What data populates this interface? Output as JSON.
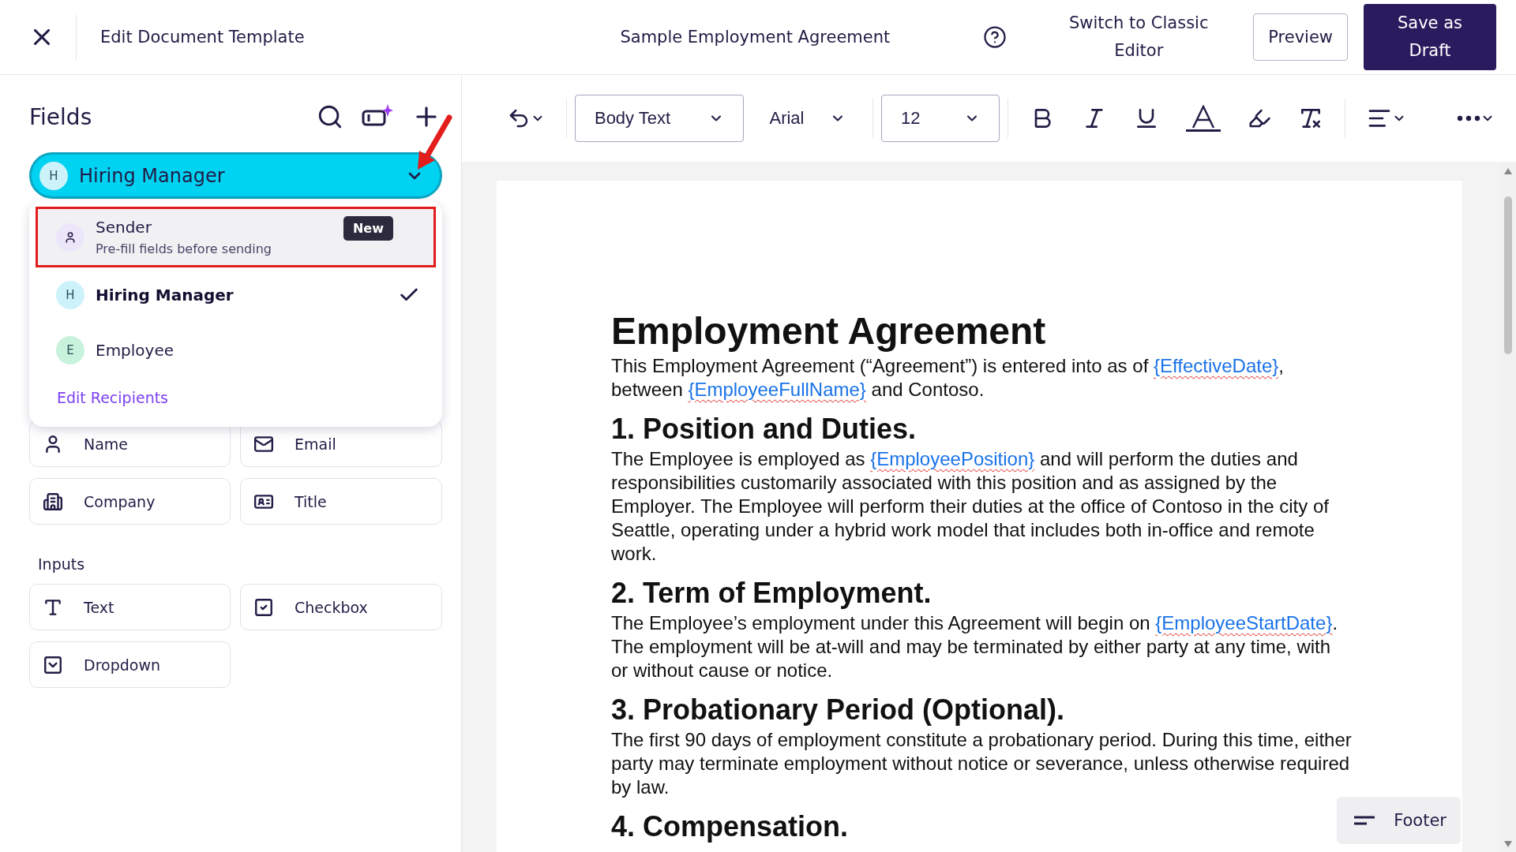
{
  "header": {
    "title": "Edit Document Template",
    "document_name": "Sample Employment Agreement",
    "switch_link": "Switch to Classic Editor",
    "buttons": [
      {
        "label": "Preview",
        "kind": "secondary"
      },
      {
        "label": "Save as Draft",
        "kind": "primary"
      }
    ]
  },
  "sidebar": {
    "title": "Fields",
    "recipient_selector": {
      "initial": "H",
      "label": "Hiring Manager",
      "color": "#cdf3fa",
      "expanded": true,
      "annotated": true
    },
    "recipient_menu": {
      "items": [
        {
          "kind": "person",
          "name": "Sender",
          "description": "Pre-fill fields before sending",
          "badge": "New",
          "selected": false,
          "annotated": true,
          "color": "#ece6fb"
        },
        {
          "kind": "initial",
          "initial": "H",
          "name": "Hiring Manager",
          "selected": true,
          "annotated": false,
          "color": "#cdf3fa"
        },
        {
          "kind": "initial",
          "initial": "E",
          "name": "Employee",
          "selected": false,
          "annotated": false,
          "color": "#c9f2dc"
        }
      ],
      "footer_link": "Edit Recipients"
    },
    "field_groups": [
      {
        "fields": [
          {
            "label": "Name",
            "kind": "person"
          },
          {
            "label": "Email",
            "kind": "email"
          },
          {
            "label": "Company",
            "kind": "company"
          },
          {
            "label": "Title",
            "kind": "title"
          }
        ]
      },
      {
        "title": "Inputs",
        "fields": [
          {
            "label": "Text",
            "kind": "text"
          },
          {
            "label": "Checkbox",
            "kind": "checkbox"
          },
          {
            "label": "Dropdown",
            "kind": "dropdown"
          }
        ]
      }
    ]
  },
  "toolbar": {
    "style_select": "Body Text",
    "font_select": "Arial",
    "size_select": "12"
  },
  "document": {
    "blocks": [
      {
        "kind": "title",
        "parts": [
          {
            "kind": "text",
            "text": "Employment Agreement"
          }
        ]
      },
      {
        "kind": "paragraph",
        "parts": [
          {
            "kind": "text",
            "text": "This Employment Agreement (“Agreement”) is entered into as of "
          },
          {
            "kind": "field",
            "text": "{EffectiveDate}"
          },
          {
            "kind": "text",
            "text": ", between "
          },
          {
            "kind": "field",
            "text": "{EmployeeFullName}"
          },
          {
            "kind": "text",
            "text": " and Contoso."
          }
        ]
      },
      {
        "kind": "heading",
        "parts": [
          {
            "kind": "text",
            "text": "1. Position and Duties."
          }
        ]
      },
      {
        "kind": "paragraph",
        "parts": [
          {
            "kind": "text",
            "text": "The Employee is employed as "
          },
          {
            "kind": "field",
            "text": "{EmployeePosition}"
          },
          {
            "kind": "text",
            "text": " and will perform the duties and responsibilities customarily associated with this position and as assigned by the Employer. The Employee will perform their duties at the office of Contoso in the city of Seattle, operating under a hybrid work model that includes both in-office and remote work."
          }
        ]
      },
      {
        "kind": "heading",
        "parts": [
          {
            "kind": "text",
            "text": "2. Term of Employment."
          }
        ]
      },
      {
        "kind": "paragraph",
        "parts": [
          {
            "kind": "text",
            "text": "The Employee’s employment under this Agreement will begin on "
          },
          {
            "kind": "field",
            "text": "{EmployeeStartDate}"
          },
          {
            "kind": "text",
            "text": ". The employment will be at-will and may be terminated by either party at any time, with or without cause or notice."
          }
        ]
      },
      {
        "kind": "heading",
        "parts": [
          {
            "kind": "text",
            "text": "3. Probationary Period (Optional)."
          }
        ]
      },
      {
        "kind": "paragraph",
        "parts": [
          {
            "kind": "text",
            "text": "The first 90 days of employment constitute a probationary period. During this time, either party may terminate employment without notice or severance, unless otherwise required by law."
          }
        ]
      },
      {
        "kind": "heading",
        "parts": [
          {
            "kind": "text",
            "text": "4. Compensation."
          }
        ]
      }
    ]
  },
  "footer_button": "Footer"
}
